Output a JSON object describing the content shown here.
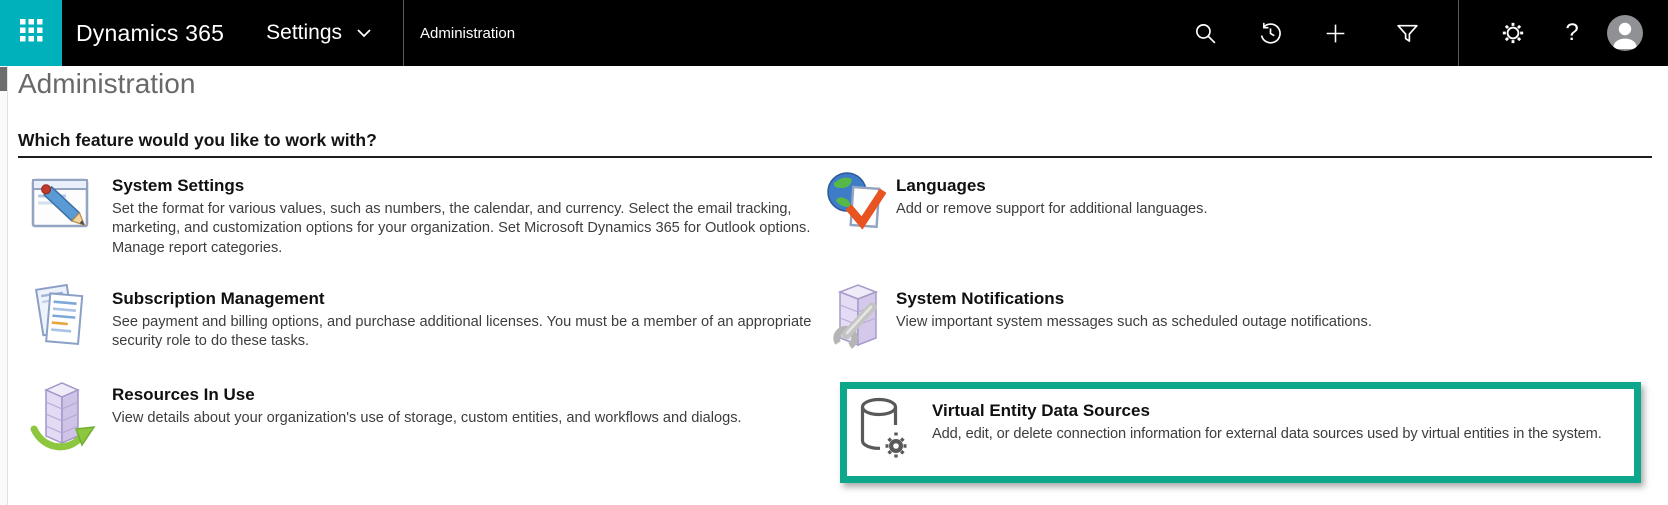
{
  "nav": {
    "app_title": "Dynamics 365",
    "area_label": "Settings",
    "breadcrumb": "Administration",
    "help_label": "?",
    "waffle_color": "#00b0ba",
    "bar_color": "#000000"
  },
  "page": {
    "title": "Administration",
    "heading": "Which feature would you like to work with?"
  },
  "features": [
    {
      "id": "system-settings",
      "title": "System Settings",
      "description": "Set the format for various values, such as numbers, the calendar, and currency. Select the email tracking, marketing, and customization options for your organization. Set Microsoft Dynamics 365 for Outlook options. Manage report categories."
    },
    {
      "id": "subscription-management",
      "title": "Subscription Management",
      "description": "See payment and billing options, and purchase additional licenses. You must be a member of an appropriate security role to do these tasks."
    },
    {
      "id": "resources-in-use",
      "title": "Resources In Use",
      "description": "View details about your organization's use of storage, custom entities, and workflows and dialogs."
    },
    {
      "id": "languages",
      "title": "Languages",
      "description": "Add or remove support for additional languages."
    },
    {
      "id": "system-notifications",
      "title": "System Notifications",
      "description": "View important system messages such as scheduled outage notifications."
    },
    {
      "id": "virtual-entity-data-sources",
      "title": "Virtual Entity Data Sources",
      "description": "Add, edit, or delete connection information for external data sources used by virtual entities in the system.",
      "highlighted": true
    }
  ],
  "highlight": {
    "color": "#0ea78c"
  }
}
